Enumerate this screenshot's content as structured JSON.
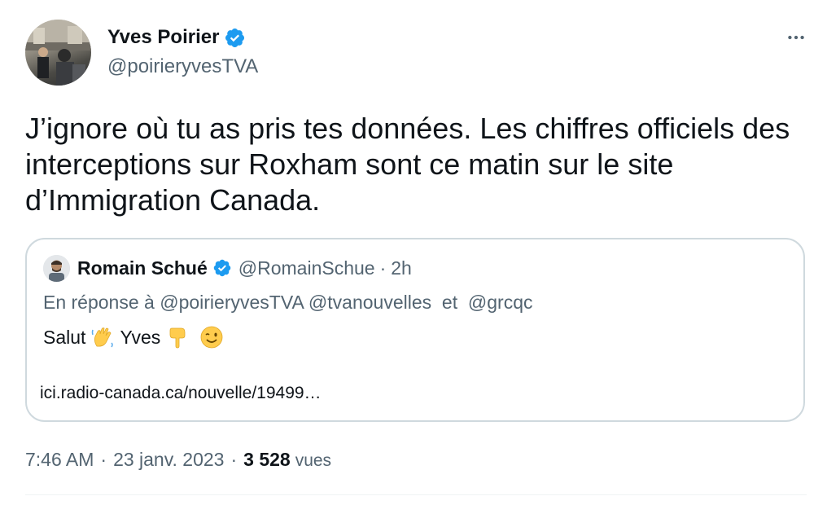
{
  "tweet": {
    "author": {
      "name": "Yves Poirier",
      "handle": "@poirieryvesTVA",
      "verified": true
    },
    "more_icon": "more-horizontal-icon",
    "text": "J’ignore où tu as pris tes données. Les chiffres officiels des interceptions sur Roxham sont ce matin sur le site d’Immigration Canada.",
    "quote": {
      "author_name": "Romain Schué",
      "handle": "@RomainSchue",
      "separator": "·",
      "time": "2h",
      "reply_prefix": "En réponse à",
      "reply_mention_1": "@poirieryvesTVA",
      "reply_mention_2": "@tvanouvelles",
      "reply_conjunction": "et",
      "reply_mention_3": "@grcqc",
      "text_part_1": "Salut",
      "text_part_2": "Yves",
      "emojis": [
        "waving-hand-emoji",
        "pointing-down-emoji",
        "winking-face-emoji"
      ],
      "link": "ici.radio-canada.ca/nouvelle/19499…"
    },
    "meta": {
      "time": "7:46 AM",
      "separator": "·",
      "date": "23 janv. 2023",
      "views_count": "3 528",
      "views_label": "vues"
    }
  },
  "colors": {
    "text_primary": "#0f1419",
    "text_secondary": "#536471",
    "verified_blue": "#1d9bf0",
    "border": "#cfd9de"
  }
}
